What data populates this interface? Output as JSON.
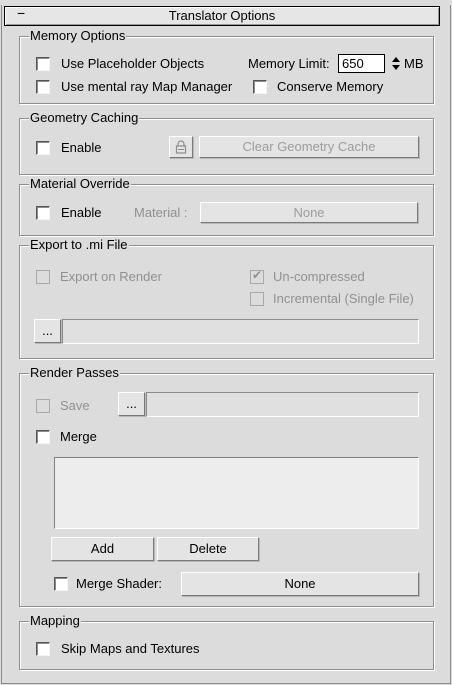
{
  "header": {
    "collapse_symbol": "−",
    "title": "Translator Options"
  },
  "memory": {
    "group_label": "Memory Options",
    "placeholder_label": "Use Placeholder Objects",
    "memory_limit_label": "Memory Limit:",
    "memory_limit_value": "650",
    "memory_unit": "MB",
    "map_manager_label": "Use mental ray Map Manager",
    "conserve_label": "Conserve Memory"
  },
  "geometry": {
    "group_label": "Geometry Caching",
    "enable_label": "Enable",
    "clear_button": "Clear Geometry Cache"
  },
  "material": {
    "group_label": "Material Override",
    "enable_label": "Enable",
    "material_label": "Material :",
    "material_button": "None"
  },
  "export": {
    "group_label": "Export to .mi File",
    "export_on_render_label": "Export on Render",
    "uncompressed_label": "Un-compressed",
    "uncompressed_checked": true,
    "incremental_label": "Incremental (Single File)",
    "browse_button": "..."
  },
  "passes": {
    "group_label": "Render Passes",
    "save_label": "Save",
    "save_browse_button": "...",
    "merge_label": "Merge",
    "add_button": "Add",
    "delete_button": "Delete",
    "merge_shader_label": "Merge Shader:",
    "merge_shader_button": "None"
  },
  "mapping": {
    "group_label": "Mapping",
    "skip_maps_label": "Skip Maps and Textures"
  }
}
